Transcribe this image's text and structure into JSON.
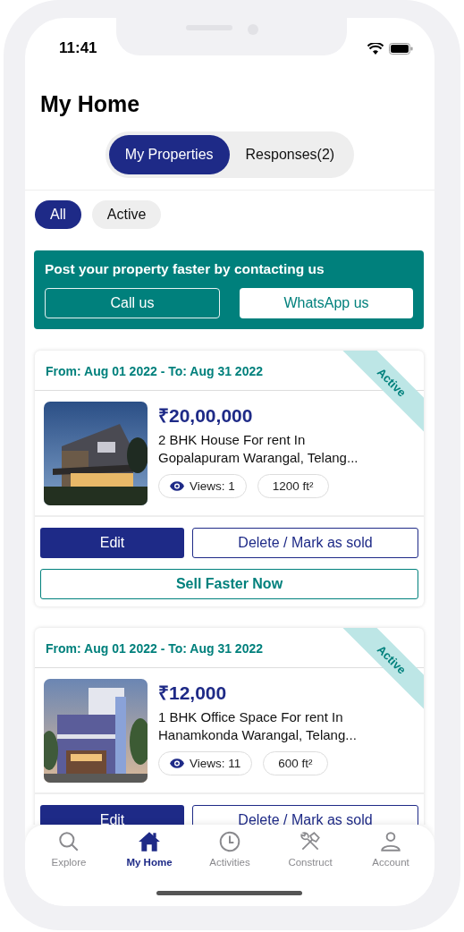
{
  "status_bar": {
    "time": "11:41"
  },
  "title": "My Home",
  "segments": [
    {
      "label": "My Properties",
      "selected": true
    },
    {
      "label": "Responses(2)",
      "selected": false
    }
  ],
  "filters": [
    {
      "label": "All",
      "selected": true
    },
    {
      "label": "Active",
      "selected": false
    }
  ],
  "banner": {
    "text": "Post your property faster by contacting us",
    "buttons": [
      {
        "label": "Call us",
        "kind": "outline"
      },
      {
        "label": "WhatsApp us",
        "kind": "solid"
      }
    ]
  },
  "listings": [
    {
      "dates": "From: Aug 01 2022 - To: Aug 31 2022",
      "status": "Active",
      "price": "₹20,00,000",
      "description": "2 BHK House For rent In Gopalapuram Warangal, Telang...",
      "views": "Views: 1",
      "area": "1200 ft²",
      "actions": [
        "Edit",
        "Delete / Mark as sold"
      ],
      "promote": "Sell Faster Now"
    },
    {
      "dates": "From: Aug 01 2022 - To: Aug 31 2022",
      "status": "Active",
      "price": "₹12,000",
      "description": "1 BHK Office Space For rent In Hanamkonda Warangal, Telang...",
      "views": "Views: 11",
      "area": "600 ft²",
      "actions": [
        "Edit",
        "Delete / Mark as sold"
      ]
    }
  ],
  "tab_bar": [
    {
      "label": "Explore",
      "selected": false
    },
    {
      "label": "My Home",
      "selected": true
    },
    {
      "label": "Activities",
      "selected": false
    },
    {
      "label": "Construct",
      "selected": false
    },
    {
      "label": "Account",
      "selected": false
    }
  ]
}
